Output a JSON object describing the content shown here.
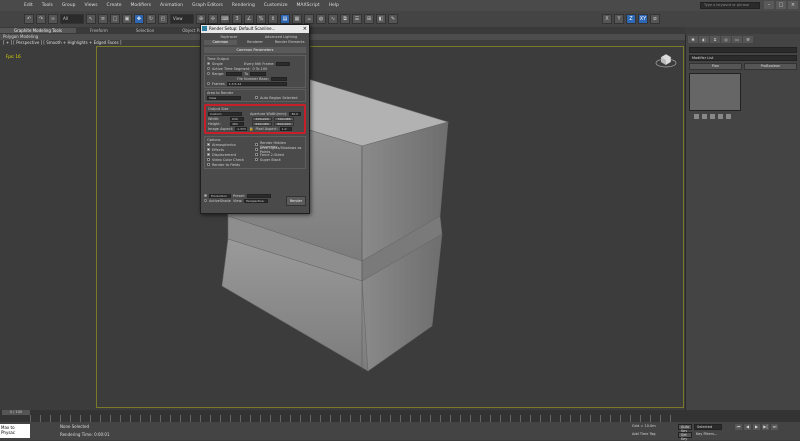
{
  "app": {
    "logo": "S",
    "search_placeholder": "Type a keyword or phrase"
  },
  "menu": [
    "Edit",
    "Tools",
    "Group",
    "Views",
    "Create",
    "Modifiers",
    "Animation",
    "Graph Editors",
    "Rendering",
    "Customize",
    "MAXScript",
    "Help"
  ],
  "toolbar": {
    "filter": "All",
    "view": "View"
  },
  "ribbon": {
    "tabs": [
      "Graphite Modeling Tools",
      "Freeform",
      "Selection",
      "Object Paint"
    ],
    "active": 0,
    "subtitle": "Polygon Modeling"
  },
  "viewport": {
    "label": "[ + ] [ Perspective ] [ Smooth + Highlights + Edged Faces ]",
    "fps": "Fps: 16"
  },
  "right_panel": {
    "modifier_list": "Modifier List",
    "btn1": "Plan",
    "btn2": "ProBoolean"
  },
  "dialog": {
    "title": "Render Setup: Default Scanline...",
    "tabs_row1": [
      "Raytracer",
      "Advanced Lighting"
    ],
    "tabs_row2": [
      "Common",
      "Renderer",
      "Render Elements"
    ],
    "active_tab": "Common",
    "section": "Common Parameters",
    "time_output": {
      "title": "Time Output",
      "single": "Single",
      "every_nth": "Every Nth Frame:",
      "active_segment": "Active Time Segment:",
      "active_segment_value": "0 To 100",
      "range": "Range:",
      "to": "To",
      "file_number_base": "File Number Base:",
      "frames": "Frames",
      "frames_value": "1,3,5-12"
    },
    "area_to_render": {
      "title": "Area to Render",
      "value": "View",
      "auto_region": "Auto Region Selected"
    },
    "output_size": {
      "title": "Output Size",
      "preset": "Custom",
      "aperture_label": "Aperture Width(mm):",
      "aperture_value": "36.0",
      "width_label": "Width:",
      "width_value": "640",
      "height_label": "Height:",
      "height_value": "480",
      "res": [
        "320x240",
        "720x486",
        "640x480",
        "800x600"
      ],
      "image_aspect_label": "Image Aspect:",
      "image_aspect_value": "1.333",
      "pixel_aspect_label": "Pixel Aspect:",
      "pixel_aspect_value": "1.0"
    },
    "options": {
      "title": "Options",
      "items": [
        {
          "label": "Atmospherics",
          "on": true
        },
        {
          "label": "Render Hidden Geometry",
          "on": false
        },
        {
          "label": "Effects",
          "on": true
        },
        {
          "label": "Area Lights/Shadows as Points",
          "on": false
        },
        {
          "label": "Displacement",
          "on": true
        },
        {
          "label": "Force 2-Sided",
          "on": false
        },
        {
          "label": "Video Color Check",
          "on": false
        },
        {
          "label": "Super Black",
          "on": false
        },
        {
          "label": "Render to Fields",
          "on": false
        }
      ]
    },
    "bottom": {
      "mode": "Production",
      "preset_label": "Preset:",
      "preset_value": "",
      "activeshade": "ActiveShade",
      "view_label": "View:",
      "view_value": "Perspective",
      "render": "Render"
    }
  },
  "timeline": {
    "frame": "0 / 100"
  },
  "status": {
    "maxscript": "Max to Physac",
    "line1": "None Selected",
    "line2": "Rendering Time: 0:00:01",
    "grid": "Grid = 10.0m",
    "autokey": "Auto Key",
    "autokey_value": "Selected",
    "setkey": "Set Key",
    "keyfilters": "Key Filters...",
    "add_time_tag": "Add Time Tag"
  }
}
